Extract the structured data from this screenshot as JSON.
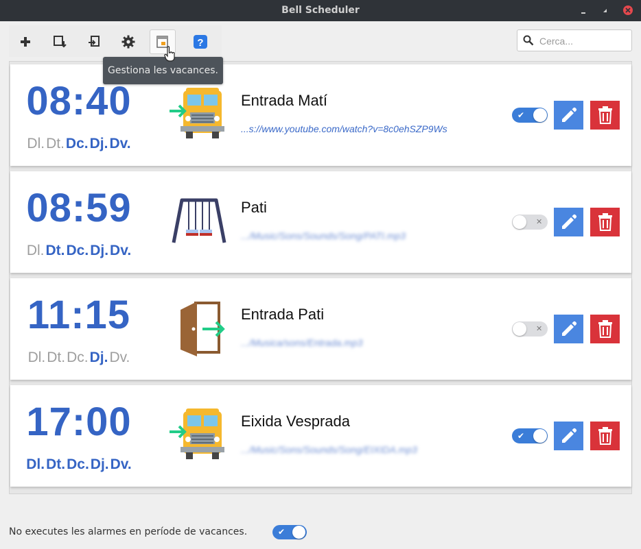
{
  "window": {
    "title": "Bell Scheduler"
  },
  "toolbar": {
    "buttons": [
      {
        "name": "add",
        "icon": "plus-icon"
      },
      {
        "name": "export",
        "icon": "export-icon"
      },
      {
        "name": "import",
        "icon": "import-icon"
      },
      {
        "name": "settings",
        "icon": "gear-icon"
      },
      {
        "name": "holidays",
        "icon": "calendar-icon",
        "active": true
      },
      {
        "name": "help",
        "icon": "help-icon"
      }
    ],
    "tooltip": "Gestiona les vacances."
  },
  "search": {
    "placeholder": "Cerca..."
  },
  "bells": [
    {
      "time": "08:40",
      "days": [
        {
          "label": "Dl.",
          "active": false
        },
        {
          "label": "Dt.",
          "active": false
        },
        {
          "label": "Dc.",
          "active": true
        },
        {
          "label": "Dj.",
          "active": true
        },
        {
          "label": "Dv.",
          "active": true
        }
      ],
      "image": "school-bus-entry-icon",
      "name": "Entrada Matí",
      "sound": "...s://www.youtube.com/watch?v=8c0ehSZP9Ws",
      "sound_obscured": false,
      "enabled": true
    },
    {
      "time": "08:59",
      "days": [
        {
          "label": "Dl.",
          "active": false
        },
        {
          "label": "Dt.",
          "active": true
        },
        {
          "label": "Dc.",
          "active": true
        },
        {
          "label": "Dj.",
          "active": true
        },
        {
          "label": "Dv.",
          "active": true
        }
      ],
      "image": "swing-icon",
      "name": "Pati",
      "sound": ".../Music/Sons/Sounds/Song/PATI.mp3",
      "sound_obscured": true,
      "enabled": false
    },
    {
      "time": "11:15",
      "days": [
        {
          "label": "Dl.",
          "active": false
        },
        {
          "label": "Dt.",
          "active": false
        },
        {
          "label": "Dc.",
          "active": false
        },
        {
          "label": "Dj.",
          "active": true
        },
        {
          "label": "Dv.",
          "active": false
        }
      ],
      "image": "door-exit-icon",
      "name": "Entrada Pati",
      "sound": ".../Musica/sons/Entrada.mp3",
      "sound_obscured": true,
      "enabled": false
    },
    {
      "time": "17:00",
      "days": [
        {
          "label": "Dl.",
          "active": true
        },
        {
          "label": "Dt.",
          "active": true
        },
        {
          "label": "Dc.",
          "active": true
        },
        {
          "label": "Dj.",
          "active": true
        },
        {
          "label": "Dv.",
          "active": true
        }
      ],
      "image": "school-bus-entry-icon",
      "name": "Eixida Vesprada",
      "sound": ".../Music/Sons/Sounds/Song/EIXIDA.mp3",
      "sound_obscured": true,
      "enabled": true
    }
  ],
  "footer": {
    "label": "No executes les alarmes en període de vacances.",
    "enabled": true
  },
  "colors": {
    "accent": "#3564c4",
    "edit": "#4a86e0",
    "delete": "#d9333a",
    "toggle_on": "#3b7dd8"
  }
}
